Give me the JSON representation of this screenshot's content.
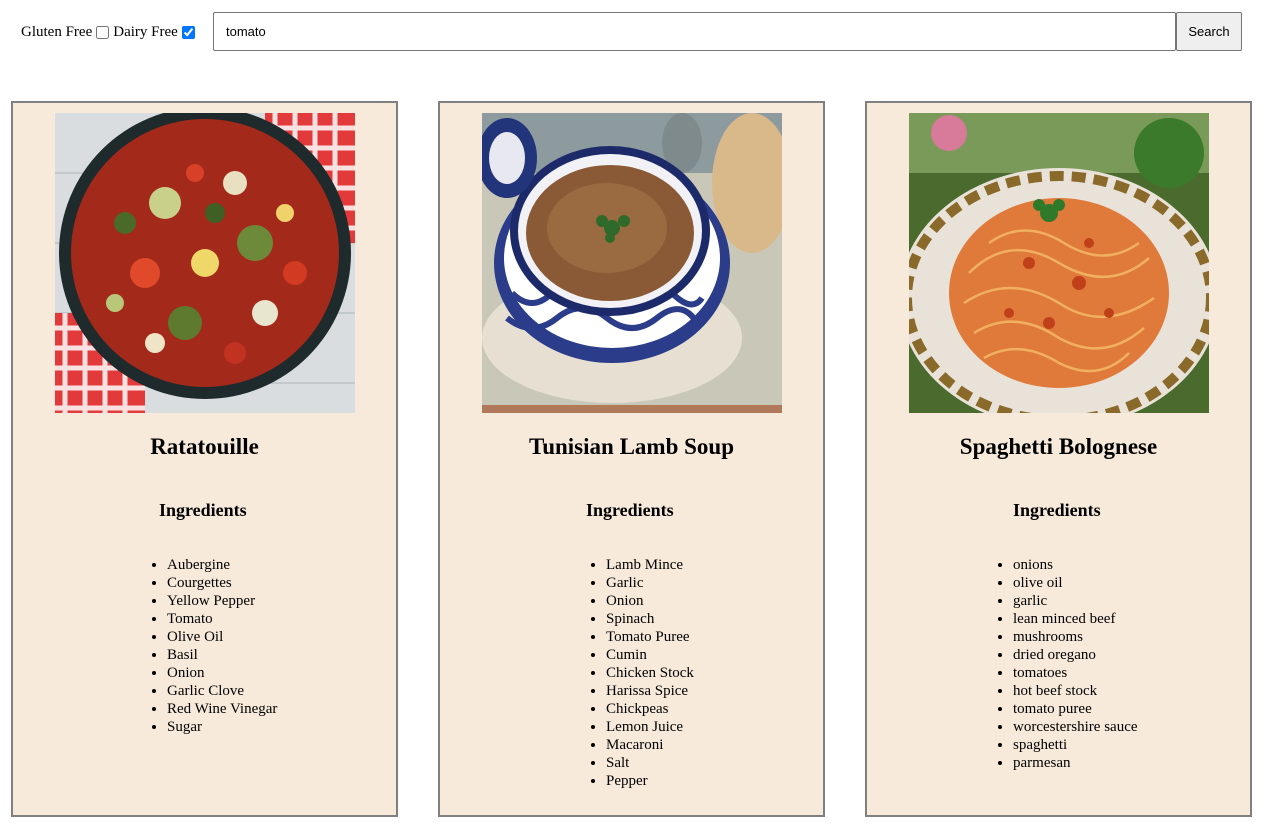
{
  "filters": {
    "gluten_free_label": "Gluten Free",
    "gluten_free_checked": false,
    "dairy_free_label": "Dairy Free",
    "dairy_free_checked": true
  },
  "search": {
    "value": "tomato",
    "button_label": "Search"
  },
  "recipes": [
    {
      "title": "Ratatouille",
      "ingredients_heading": "Ingredients",
      "ingredients": [
        "Aubergine",
        "Courgettes",
        "Yellow Pepper",
        "Tomato",
        "Olive Oil",
        "Basil",
        "Onion",
        "Garlic Clove",
        "Red Wine Vinegar",
        "Sugar"
      ]
    },
    {
      "title": "Tunisian Lamb Soup",
      "ingredients_heading": "Ingredients",
      "ingredients": [
        "Lamb Mince",
        "Garlic",
        "Onion",
        "Spinach",
        "Tomato Puree",
        "Cumin",
        "Chicken Stock",
        "Harissa Spice",
        "Chickpeas",
        "Lemon Juice",
        "Macaroni",
        "Salt",
        "Pepper"
      ]
    },
    {
      "title": "Spaghetti Bolognese",
      "ingredients_heading": "Ingredients",
      "ingredients": [
        "onions",
        "olive oil",
        "garlic",
        "lean minced beef",
        "mushrooms",
        "dried oregano",
        "tomatoes",
        "hot beef stock",
        "tomato puree",
        "worcestershire sauce",
        "spaghetti",
        "parmesan"
      ]
    }
  ]
}
